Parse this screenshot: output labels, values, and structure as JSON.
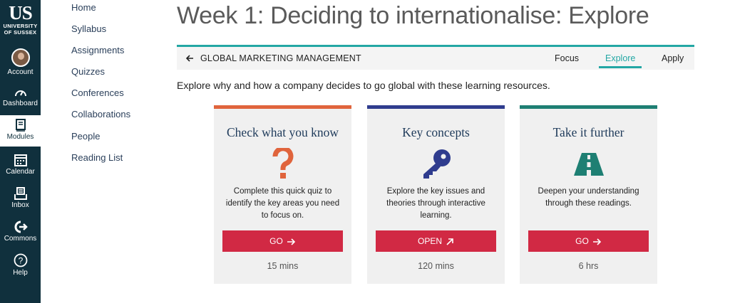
{
  "global_nav": {
    "logo_mark": "US",
    "logo_text_line1": "UNIVERSITY",
    "logo_text_line2": "OF SUSSEX",
    "items": [
      {
        "label": "Account",
        "icon": "avatar"
      },
      {
        "label": "Dashboard",
        "icon": "dashboard-icon"
      },
      {
        "label": "Modules",
        "icon": "modules-icon"
      },
      {
        "label": "Calendar",
        "icon": "calendar-icon"
      },
      {
        "label": "Inbox",
        "icon": "inbox-icon"
      },
      {
        "label": "Commons",
        "icon": "commons-icon"
      },
      {
        "label": "Help",
        "icon": "help-icon"
      }
    ]
  },
  "course_nav": {
    "items": [
      "Home",
      "Syllabus",
      "Assignments",
      "Quizzes",
      "Conferences",
      "Collaborations",
      "People",
      "Reading List"
    ]
  },
  "page_title": "Week 1: Deciding to internationalise: Explore",
  "subnav": {
    "back_icon": "arrow-left-icon",
    "course_name": "GLOBAL MARKETING MANAGEMENT",
    "tabs": [
      "Focus",
      "Explore",
      "Apply"
    ],
    "active_tab": "Explore"
  },
  "intro": "Explore why and how a company decides to go global with these learning resources.",
  "cards": [
    {
      "title": "Check what you know",
      "icon": "question-mark-icon",
      "description": "Complete this quick quiz to identify the key areas you need to focus on.",
      "button": "GO",
      "button_icon": "arrow-right-icon",
      "duration": "15 mins",
      "accent": "#e0643c"
    },
    {
      "title": "Key concepts",
      "icon": "key-icon",
      "description": "Explore the key issues and theories through interactive learning.",
      "button": "OPEN",
      "button_icon": "arrow-up-right-icon",
      "duration": "120 mins",
      "accent": "#2f3c8e"
    },
    {
      "title": "Take it further",
      "icon": "road-icon",
      "description": "Deepen your understanding through these readings.",
      "button": "GO",
      "button_icon": "arrow-right-icon",
      "duration": "6 hrs",
      "accent": "#1e7f73"
    }
  ],
  "colors": {
    "nav_bg": "#10303d",
    "teal": "#23a7a4",
    "button": "#d12944"
  }
}
